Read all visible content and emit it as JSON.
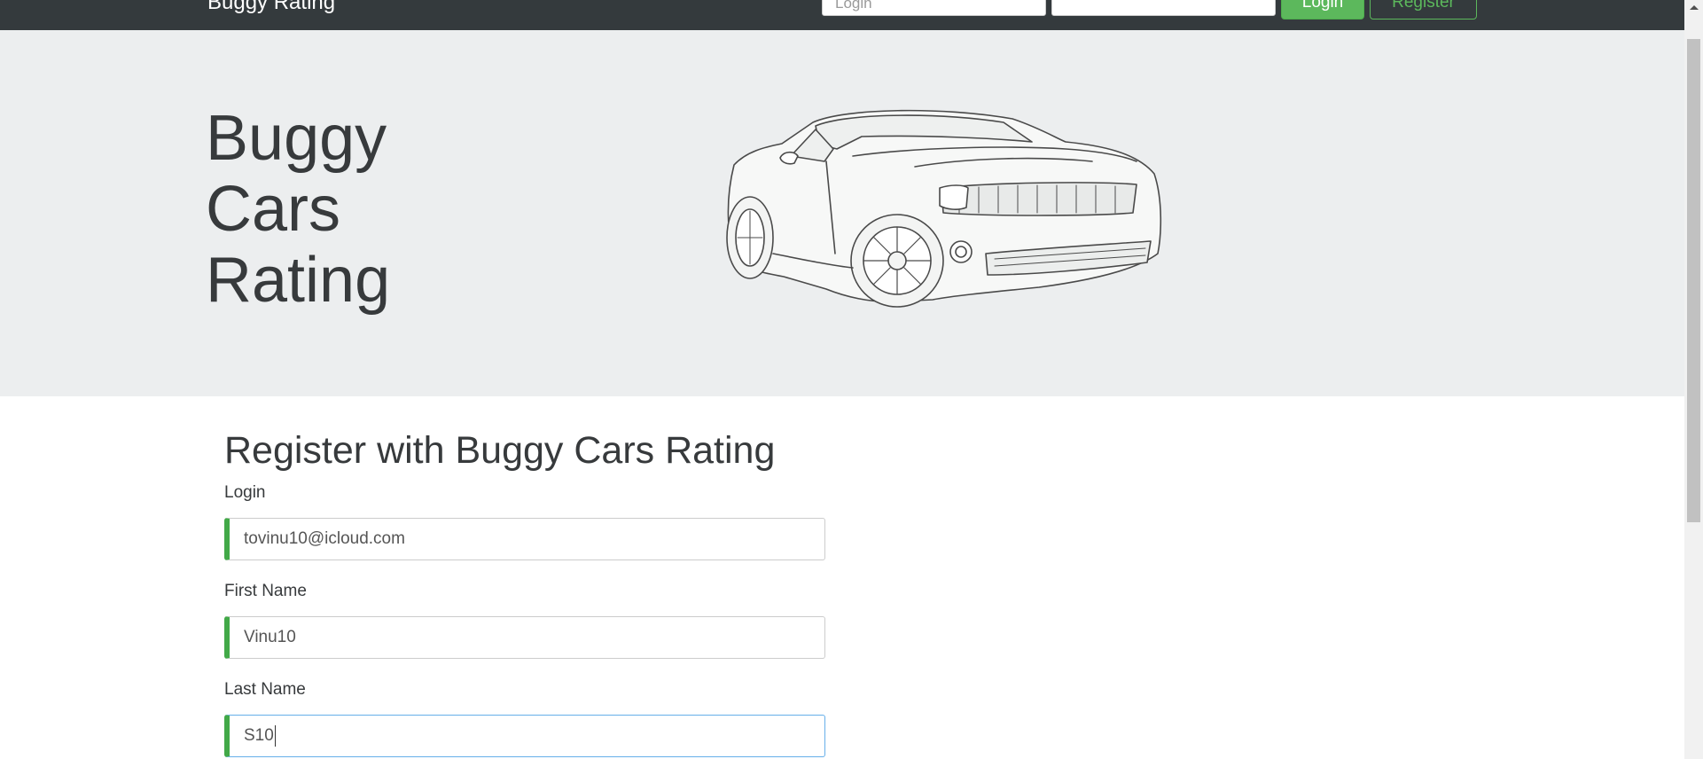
{
  "navbar": {
    "brand": "Buggy Rating",
    "login_placeholder": "Login",
    "password_placeholder": "",
    "login_button": "Login",
    "register_button": "Register"
  },
  "hero": {
    "title_lines": [
      "Buggy",
      "Cars",
      "Rating"
    ]
  },
  "form": {
    "heading": "Register with Buggy Cars Rating",
    "fields": [
      {
        "label": "Login",
        "value": "tovinu10@icloud.com"
      },
      {
        "label": "First Name",
        "value": "Vinu10"
      },
      {
        "label": "Last Name",
        "value": "S10"
      }
    ]
  },
  "colors": {
    "navbar_bg": "#343a3d",
    "success_green": "#5cb85c",
    "valid_border": "#42a948",
    "jumbotron_bg": "#eceeef"
  }
}
